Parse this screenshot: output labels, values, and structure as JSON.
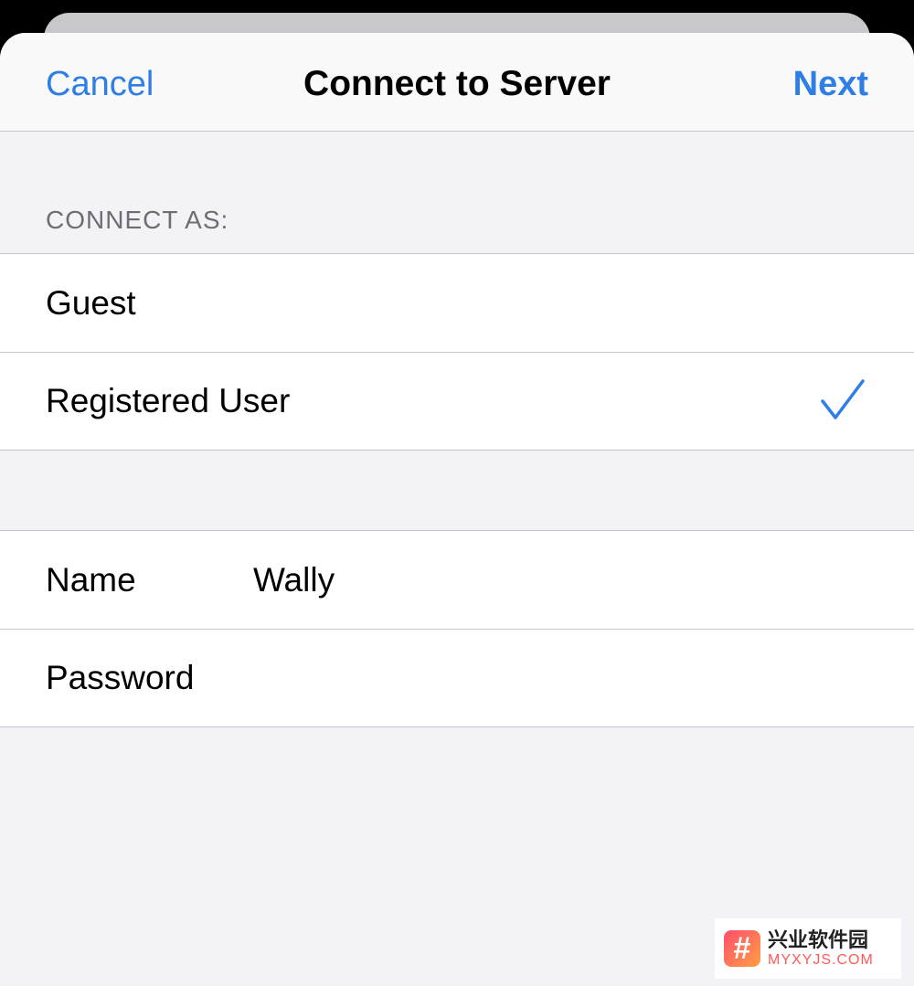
{
  "navbar": {
    "cancel_label": "Cancel",
    "title": "Connect to Server",
    "next_label": "Next"
  },
  "connect_as": {
    "header": "CONNECT AS:",
    "options": [
      {
        "label": "Guest",
        "selected": false
      },
      {
        "label": "Registered User",
        "selected": true
      }
    ]
  },
  "credentials": {
    "name_label": "Name",
    "name_value": "Wally",
    "password_label": "Password",
    "password_value": ""
  },
  "watermark": {
    "logo_glyph": "#",
    "text_cn": "兴业软件园",
    "text_en": "MYXYJS.COM"
  },
  "colors": {
    "accent": "#2f7ee6",
    "background": "#f2f2f7",
    "separator": "#c6c6c8",
    "section_header": "#6d6d72"
  }
}
